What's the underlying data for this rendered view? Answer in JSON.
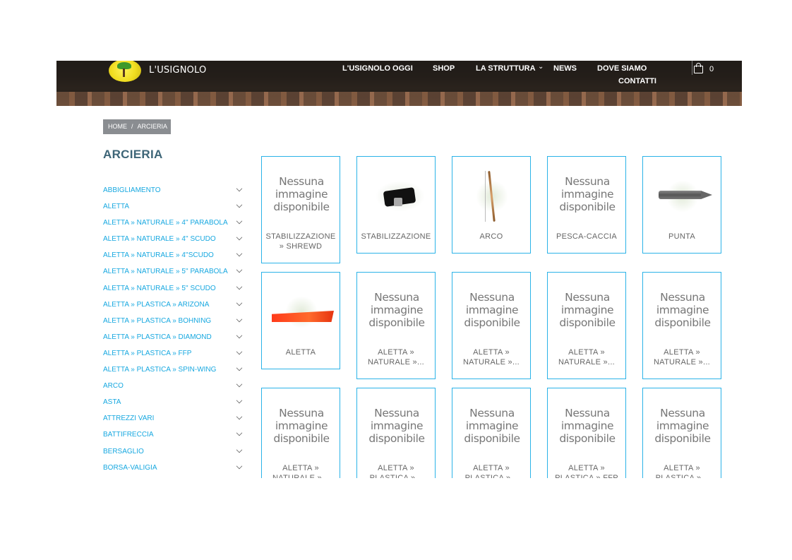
{
  "header": {
    "brand": "L'USIGNOLO",
    "nav": [
      {
        "label": "L'USIGNOLO OGGI"
      },
      {
        "label": "SHOP"
      },
      {
        "label": "LA STRUTTURA"
      },
      {
        "label": "NEWS"
      },
      {
        "label": "DOVE SIAMO"
      },
      {
        "label": "CONTATTI"
      }
    ],
    "cart_count": "0",
    "icons": {
      "cart": "shopping-bag-icon",
      "dropdown": "chevron-down-icon",
      "logo": "logo-icon"
    }
  },
  "breadcrumb": {
    "home": "HOME",
    "separator": "/",
    "current": "ARCIERIA"
  },
  "page": {
    "title": "ARCIERIA"
  },
  "sidebar": {
    "items": [
      {
        "label": "ABBIGLIAMENTO"
      },
      {
        "label": "ALETTA"
      },
      {
        "label": "ALETTA » NATURALE » 4'' PARABOLA"
      },
      {
        "label": "ALETTA » NATURALE » 4'' SCUDO"
      },
      {
        "label": "ALETTA » NATURALE » 4''SCUDO"
      },
      {
        "label": "ALETTA » NATURALE » 5'' PARABOLA"
      },
      {
        "label": "ALETTA » NATURALE » 5'' SCUDO"
      },
      {
        "label": "ALETTA » PLASTICA » ARIZONA"
      },
      {
        "label": "ALETTA » PLASTICA » BOHNING"
      },
      {
        "label": "ALETTA » PLASTICA » DIAMOND"
      },
      {
        "label": "ALETTA » PLASTICA » FFP"
      },
      {
        "label": "ALETTA » PLASTICA » SPIN-WING"
      },
      {
        "label": "ARCO"
      },
      {
        "label": "ASTA"
      },
      {
        "label": "ATTREZZI VARI"
      },
      {
        "label": "BATTIFRECCIA"
      },
      {
        "label": "BERSAGLIO"
      },
      {
        "label": "BORSA-VALIGIA"
      }
    ]
  },
  "products": {
    "no_image_text": "Nessuna immagine disponibile",
    "items": [
      {
        "label": "STABILIZZAZIONE » SHREWD",
        "image": "none"
      },
      {
        "label": "STABILIZZAZIONE",
        "image": "stabilizer"
      },
      {
        "label": "ARCO",
        "image": "bow"
      },
      {
        "label": "PESCA-CACCIA",
        "image": "none"
      },
      {
        "label": "PUNTA",
        "image": "arrow-tip"
      },
      {
        "label": "ALETTA",
        "image": "vane"
      },
      {
        "label": "ALETTA » NATURALE »...",
        "image": "none"
      },
      {
        "label": "ALETTA » NATURALE »...",
        "image": "none"
      },
      {
        "label": "ALETTA » NATURALE »...",
        "image": "none"
      },
      {
        "label": "ALETTA » NATURALE »...",
        "image": "none"
      },
      {
        "label": "ALETTA » NATURALE »...",
        "image": "none"
      },
      {
        "label": "ALETTA » PLASTICA »...",
        "image": "none"
      },
      {
        "label": "ALETTA » PLASTICA »...",
        "image": "none"
      },
      {
        "label": "ALETTA » PLASTICA » FFP",
        "image": "none"
      },
      {
        "label": "ALETTA » PLASTICA »...",
        "image": "none"
      }
    ]
  },
  "colors": {
    "accent": "#17a8e0",
    "card_border": "#2bb3e8",
    "title": "#3d6577",
    "breadcrumb_bg": "#8a8d91"
  }
}
